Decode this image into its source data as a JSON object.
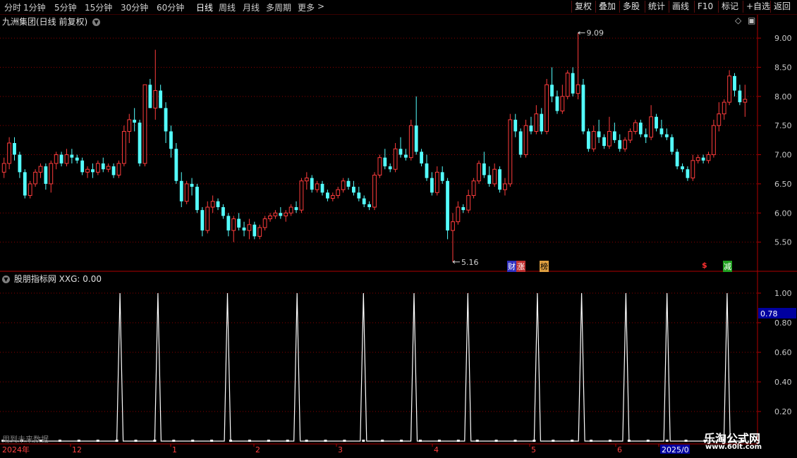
{
  "toolbar": {
    "periods": [
      "分时",
      "1分钟",
      "5分钟",
      "15分钟",
      "30分钟",
      "60分钟",
      "日线",
      "周线",
      "月线",
      "多周期",
      "更多"
    ],
    "active_period": "日线",
    "more_arrow": ">",
    "right_buttons": [
      "复权",
      "叠加",
      "多股",
      "统计",
      "画线",
      "F10",
      "标记",
      "+自选",
      "返回"
    ]
  },
  "main_panel": {
    "title": "九洲集团(日线 前复权)",
    "high_label": "9.09",
    "low_label": "5.16",
    "event_tags": [
      "财",
      "涨",
      "榜",
      "$",
      "减"
    ]
  },
  "indicator_panel": {
    "title": "股朋指标网 XXG: 0.00",
    "current_value_label": "0.78"
  },
  "date_axis": {
    "start_label": "2024年",
    "labels": [
      "12",
      "1",
      "2",
      "3",
      "4",
      "5",
      "6"
    ],
    "end_label": "2025/0"
  },
  "future_note": "用到未来数据",
  "watermark": {
    "title": "乐淘公式网",
    "url": "www.60lt.com"
  },
  "colors": {
    "up": "#ff3c3c",
    "down": "#54ffff",
    "grid": "#8c0000",
    "axis_text": "#c8c8c8",
    "line": "#ffffff",
    "background": "#000000"
  },
  "chart_data": [
    {
      "type": "candlestick",
      "title": "九洲集团(日线 前复权)",
      "ylim": [
        5.0,
        9.4
      ],
      "yticks": [
        5.5,
        6.0,
        6.5,
        7.0,
        7.5,
        8.0,
        8.5,
        9.0
      ],
      "ytick_labels": [
        "5.50",
        "6.00",
        "6.50",
        "7.00",
        "7.50",
        "8.00",
        "8.50",
        "9.00"
      ],
      "high": 9.09,
      "low": 5.16,
      "ohlc": [
        [
          6.7,
          6.95,
          6.6,
          6.85
        ],
        [
          6.85,
          7.3,
          6.75,
          7.2
        ],
        [
          7.2,
          7.3,
          6.9,
          7.0
        ],
        [
          7.0,
          7.05,
          6.6,
          6.7
        ],
        [
          6.7,
          6.75,
          6.25,
          6.3
        ],
        [
          6.3,
          6.55,
          6.25,
          6.5
        ],
        [
          6.5,
          6.75,
          6.45,
          6.7
        ],
        [
          6.7,
          6.85,
          6.6,
          6.8
        ],
        [
          6.8,
          6.85,
          6.4,
          6.5
        ],
        [
          6.5,
          6.9,
          6.35,
          6.85
        ],
        [
          6.85,
          7.05,
          6.75,
          7.0
        ],
        [
          7.0,
          7.05,
          6.8,
          6.85
        ],
        [
          6.85,
          7.1,
          6.8,
          7.0
        ],
        [
          7.0,
          7.1,
          6.85,
          6.95
        ],
        [
          6.95,
          7.0,
          6.85,
          6.9
        ],
        [
          6.9,
          6.95,
          6.65,
          6.7
        ],
        [
          6.7,
          6.8,
          6.6,
          6.75
        ],
        [
          6.75,
          6.85,
          6.6,
          6.7
        ],
        [
          6.7,
          6.9,
          6.65,
          6.85
        ],
        [
          6.85,
          6.95,
          6.7,
          6.75
        ],
        [
          6.75,
          6.85,
          6.7,
          6.8
        ],
        [
          6.8,
          6.85,
          6.6,
          6.65
        ],
        [
          6.65,
          6.9,
          6.6,
          6.85
        ],
        [
          6.85,
          7.5,
          6.8,
          7.4
        ],
        [
          7.4,
          7.7,
          7.2,
          7.6
        ],
        [
          7.6,
          7.8,
          7.4,
          7.55
        ],
        [
          7.55,
          7.6,
          6.8,
          6.85
        ],
        [
          6.85,
          8.2,
          6.8,
          8.2
        ],
        [
          8.2,
          8.3,
          7.8,
          7.8
        ],
        [
          7.8,
          8.8,
          7.6,
          8.1
        ],
        [
          8.1,
          8.2,
          7.8,
          7.8
        ],
        [
          7.8,
          7.9,
          7.2,
          7.4
        ],
        [
          7.4,
          7.5,
          6.95,
          7.1
        ],
        [
          7.1,
          7.2,
          6.5,
          6.55
        ],
        [
          6.55,
          6.7,
          6.1,
          6.2
        ],
        [
          6.2,
          6.55,
          6.15,
          6.5
        ],
        [
          6.5,
          6.6,
          6.3,
          6.45
        ],
        [
          6.45,
          6.5,
          6.0,
          6.05
        ],
        [
          6.05,
          6.1,
          5.6,
          5.7
        ],
        [
          5.7,
          6.2,
          5.65,
          6.1
        ],
        [
          6.1,
          6.3,
          6.0,
          6.2
        ],
        [
          6.2,
          6.25,
          6.05,
          6.1
        ],
        [
          6.1,
          6.15,
          5.9,
          5.95
        ],
        [
          5.95,
          6.0,
          5.6,
          5.7
        ],
        [
          5.7,
          5.95,
          5.5,
          5.9
        ],
        [
          5.9,
          6.0,
          5.7,
          5.75
        ],
        [
          5.75,
          5.85,
          5.6,
          5.7
        ],
        [
          5.7,
          5.9,
          5.55,
          5.8
        ],
        [
          5.8,
          5.85,
          5.55,
          5.6
        ],
        [
          5.6,
          5.8,
          5.55,
          5.75
        ],
        [
          5.75,
          5.95,
          5.7,
          5.9
        ],
        [
          5.9,
          6.0,
          5.85,
          5.95
        ],
        [
          5.95,
          6.05,
          5.9,
          6.0
        ],
        [
          6.0,
          6.1,
          5.9,
          5.95
        ],
        [
          5.95,
          6.05,
          5.85,
          6.0
        ],
        [
          6.0,
          6.15,
          5.95,
          6.1
        ],
        [
          6.1,
          6.2,
          6.0,
          6.05
        ],
        [
          6.05,
          6.6,
          6.0,
          6.55
        ],
        [
          6.55,
          6.7,
          6.4,
          6.6
        ],
        [
          6.6,
          6.65,
          6.35,
          6.4
        ],
        [
          6.4,
          6.55,
          6.35,
          6.5
        ],
        [
          6.5,
          6.55,
          6.3,
          6.35
        ],
        [
          6.35,
          6.4,
          6.2,
          6.25
        ],
        [
          6.25,
          6.35,
          6.2,
          6.3
        ],
        [
          6.3,
          6.45,
          6.25,
          6.4
        ],
        [
          6.4,
          6.6,
          6.35,
          6.55
        ],
        [
          6.55,
          6.6,
          6.4,
          6.45
        ],
        [
          6.45,
          6.55,
          6.3,
          6.35
        ],
        [
          6.35,
          6.45,
          6.2,
          6.25
        ],
        [
          6.25,
          6.3,
          6.1,
          6.15
        ],
        [
          6.15,
          6.2,
          6.05,
          6.1
        ],
        [
          6.1,
          6.7,
          6.05,
          6.65
        ],
        [
          6.65,
          7.0,
          6.6,
          6.95
        ],
        [
          6.95,
          7.1,
          6.75,
          6.8
        ],
        [
          6.8,
          6.85,
          6.7,
          6.75
        ],
        [
          6.75,
          7.2,
          6.7,
          7.1
        ],
        [
          7.1,
          7.3,
          6.95,
          7.0
        ],
        [
          7.0,
          7.1,
          6.9,
          6.95
        ],
        [
          6.95,
          7.6,
          6.9,
          7.5
        ],
        [
          7.5,
          8.0,
          7.0,
          7.05
        ],
        [
          7.05,
          7.1,
          6.8,
          6.85
        ],
        [
          6.85,
          7.0,
          6.55,
          6.6
        ],
        [
          6.6,
          6.7,
          6.3,
          6.35
        ],
        [
          6.35,
          6.8,
          6.3,
          6.7
        ],
        [
          6.7,
          6.8,
          6.5,
          6.55
        ],
        [
          6.55,
          6.6,
          5.55,
          5.7
        ],
        [
          5.7,
          6.0,
          5.16,
          5.85
        ],
        [
          5.85,
          6.2,
          5.8,
          6.1
        ],
        [
          6.1,
          6.15,
          6.0,
          6.05
        ],
        [
          6.05,
          6.4,
          6.0,
          6.3
        ],
        [
          6.3,
          6.6,
          6.25,
          6.55
        ],
        [
          6.55,
          6.9,
          6.5,
          6.85
        ],
        [
          6.85,
          7.05,
          6.6,
          6.65
        ],
        [
          6.65,
          6.8,
          6.45,
          6.5
        ],
        [
          6.5,
          6.85,
          6.45,
          6.75
        ],
        [
          6.75,
          6.8,
          6.35,
          6.4
        ],
        [
          6.4,
          6.6,
          6.3,
          6.5
        ],
        [
          6.5,
          7.7,
          6.45,
          7.6
        ],
        [
          7.6,
          7.7,
          7.3,
          7.4
        ],
        [
          7.4,
          7.45,
          6.95,
          7.0
        ],
        [
          7.0,
          7.6,
          6.95,
          7.5
        ],
        [
          7.5,
          7.65,
          7.35,
          7.4
        ],
        [
          7.4,
          7.85,
          7.35,
          7.7
        ],
        [
          7.7,
          7.8,
          7.35,
          7.4
        ],
        [
          7.4,
          8.3,
          7.35,
          8.2
        ],
        [
          8.2,
          8.5,
          7.9,
          8.0
        ],
        [
          8.0,
          8.1,
          7.7,
          7.75
        ],
        [
          7.75,
          8.2,
          7.7,
          8.0
        ],
        [
          8.0,
          8.45,
          7.95,
          8.4
        ],
        [
          8.4,
          8.5,
          8.0,
          8.05
        ],
        [
          8.05,
          9.09,
          7.95,
          8.2
        ],
        [
          8.2,
          8.3,
          7.35,
          7.4
        ],
        [
          7.4,
          7.45,
          7.05,
          7.1
        ],
        [
          7.1,
          7.5,
          7.05,
          7.4
        ],
        [
          7.4,
          7.6,
          7.2,
          7.3
        ],
        [
          7.3,
          7.35,
          7.1,
          7.15
        ],
        [
          7.15,
          7.65,
          7.1,
          7.4
        ],
        [
          7.4,
          7.55,
          7.2,
          7.25
        ],
        [
          7.25,
          7.35,
          7.05,
          7.1
        ],
        [
          7.1,
          7.3,
          7.05,
          7.25
        ],
        [
          7.25,
          7.45,
          7.2,
          7.4
        ],
        [
          7.4,
          7.6,
          7.35,
          7.55
        ],
        [
          7.55,
          7.6,
          7.3,
          7.35
        ],
        [
          7.35,
          7.45,
          7.2,
          7.3
        ],
        [
          7.3,
          7.85,
          7.25,
          7.65
        ],
        [
          7.65,
          7.7,
          7.4,
          7.45
        ],
        [
          7.45,
          7.6,
          7.3,
          7.35
        ],
        [
          7.35,
          7.45,
          7.25,
          7.3
        ],
        [
          7.3,
          7.35,
          7.0,
          7.05
        ],
        [
          7.05,
          7.1,
          6.75,
          6.8
        ],
        [
          6.8,
          6.85,
          6.7,
          6.75
        ],
        [
          6.75,
          6.8,
          6.55,
          6.6
        ],
        [
          6.6,
          7.0,
          6.55,
          6.9
        ],
        [
          6.9,
          7.0,
          6.85,
          6.95
        ],
        [
          6.95,
          7.0,
          6.85,
          6.9
        ],
        [
          6.9,
          7.05,
          6.85,
          7.0
        ],
        [
          7.0,
          7.6,
          6.95,
          7.5
        ],
        [
          7.5,
          7.9,
          7.4,
          7.7
        ],
        [
          7.7,
          7.95,
          7.6,
          7.9
        ],
        [
          7.9,
          8.45,
          7.85,
          8.35
        ],
        [
          8.35,
          8.4,
          8.0,
          8.1
        ],
        [
          8.1,
          8.2,
          7.85,
          7.9
        ],
        [
          7.9,
          8.2,
          7.65,
          7.95
        ]
      ],
      "event_tags": [
        "财",
        "涨",
        "榜",
        "$",
        "减"
      ]
    },
    {
      "type": "line",
      "series": [
        {
          "name": "XXG"
        }
      ],
      "ylim": [
        0.0,
        1.1
      ],
      "yticks": [
        0.2,
        0.4,
        0.6,
        0.8,
        1.0
      ],
      "ytick_labels": [
        "0.20",
        "0.40",
        "0.60",
        "0.80",
        "1.00"
      ],
      "current_value": 0.78,
      "spike_indices": [
        37,
        49,
        71,
        93,
        114,
        130,
        147,
        169,
        183,
        197,
        210,
        229
      ],
      "spike_value": 1.0,
      "n_points": 236,
      "baseline_value": 0.0
    }
  ]
}
